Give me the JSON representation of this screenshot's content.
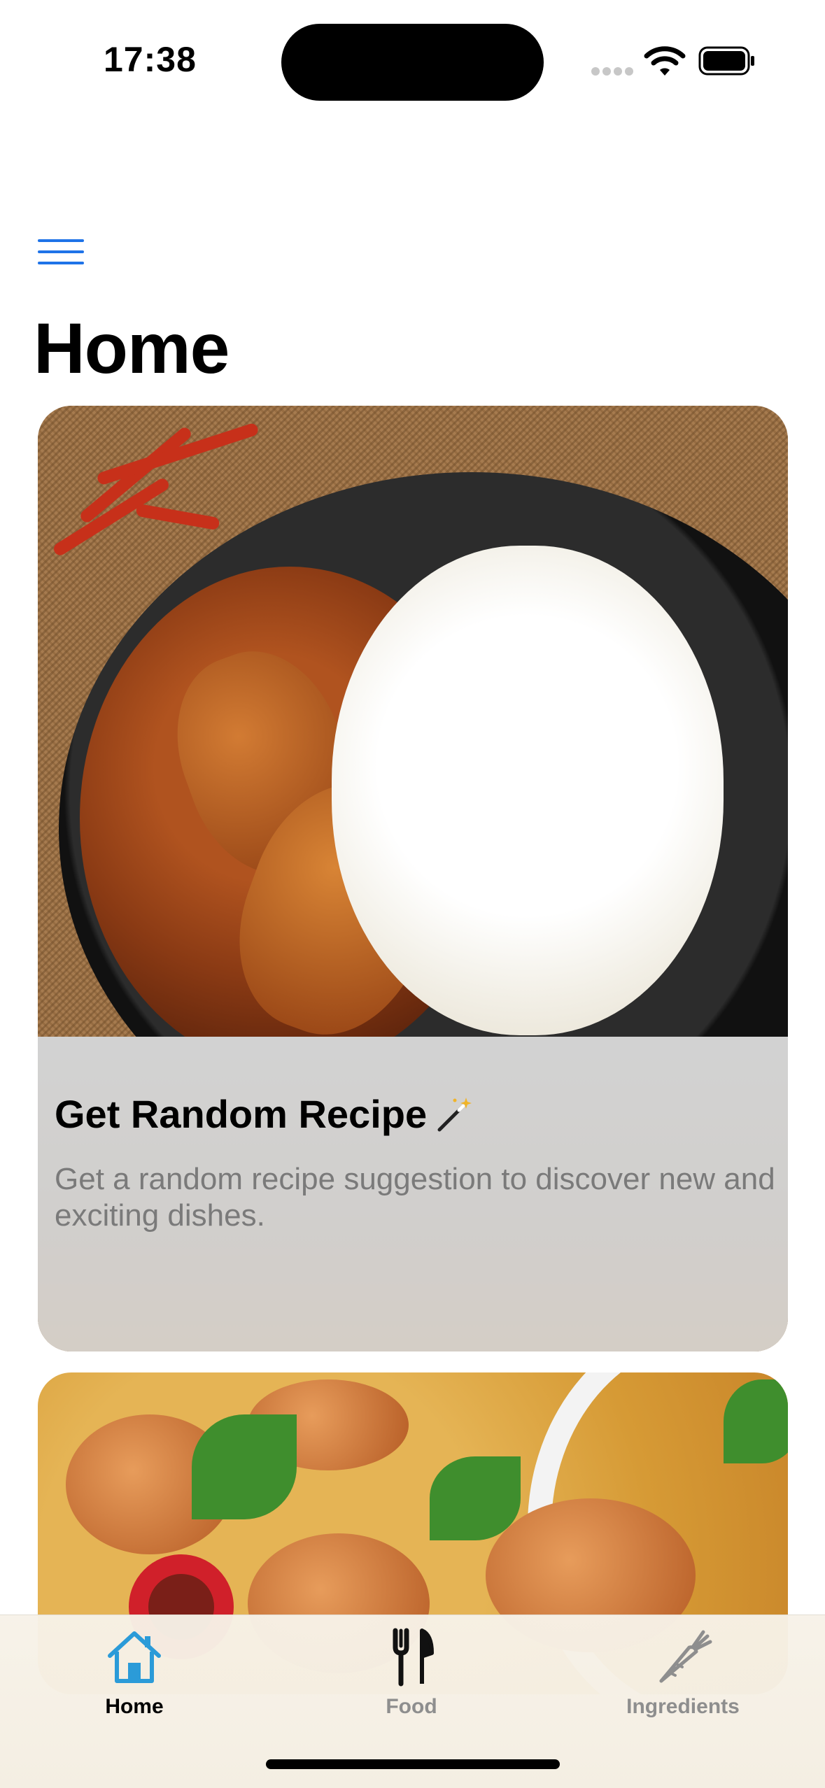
{
  "status_bar": {
    "time": "17:38",
    "icons": [
      "signal-icon",
      "wifi-icon",
      "battery-icon"
    ]
  },
  "nav": {
    "menu_icon": "menu-icon",
    "accent_color": "#1E73E8"
  },
  "page": {
    "title": "Home"
  },
  "cards": [
    {
      "title": "Get Random Recipe",
      "title_icon": "magic-wand-icon",
      "description": "Get a random recipe suggestion to discover new and exciting dishes.",
      "image": "curry-chicken-rice-photo"
    },
    {
      "image": "shrimp-curry-photo"
    }
  ],
  "tab_bar": {
    "tabs": [
      {
        "label": "Home",
        "icon": "house-icon",
        "selected": true
      },
      {
        "label": "Food",
        "icon": "fork-knife-icon",
        "selected": false
      },
      {
        "label": "Ingredients",
        "icon": "carrot-icon",
        "selected": false
      }
    ],
    "selected_color": "#2B9BD8",
    "unselected_color": "#8E8E8E"
  }
}
